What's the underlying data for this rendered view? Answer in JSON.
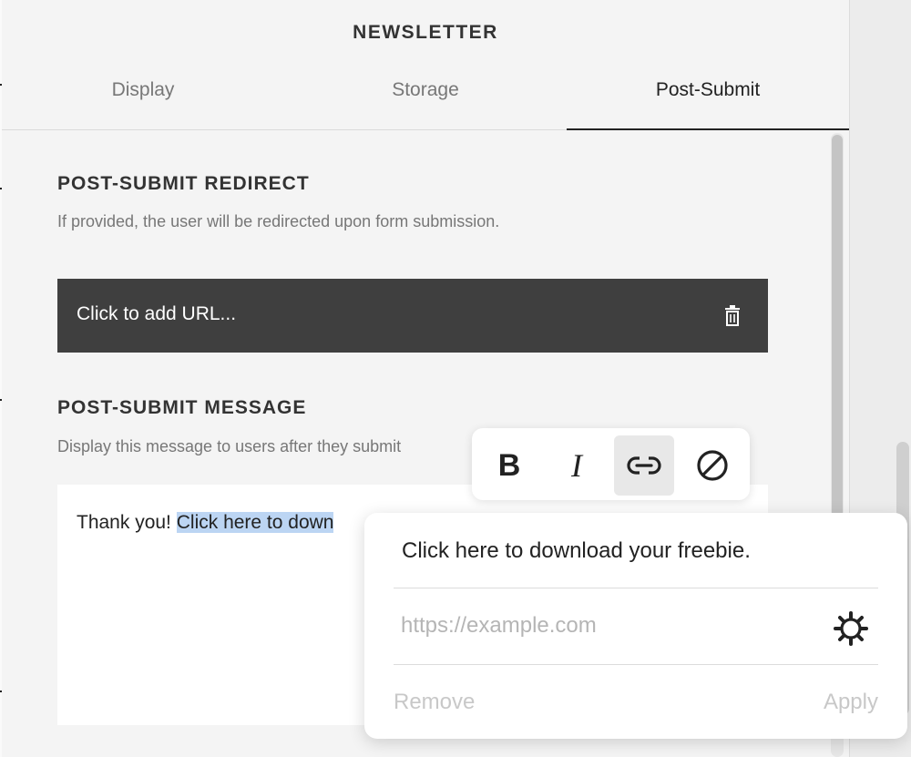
{
  "panel": {
    "title": "NEWSLETTER",
    "tabs": [
      {
        "label": "Display",
        "active": false
      },
      {
        "label": "Storage",
        "active": false
      },
      {
        "label": "Post-Submit",
        "active": true
      }
    ]
  },
  "redirect": {
    "heading": "POST-SUBMIT REDIRECT",
    "description": "If provided, the user will be redirected upon form submission.",
    "url_placeholder_text": "Click to add URL..."
  },
  "message": {
    "heading": "POST-SUBMIT MESSAGE",
    "description": "Display this message to users after they submit",
    "text_plain": "Thank you! ",
    "text_selected": "Click here to down"
  },
  "toolbar": {
    "icons": [
      "bold-icon",
      "italic-icon",
      "link-icon",
      "clear-format-icon"
    ],
    "bold_glyph": "B",
    "italic_glyph": "I",
    "active": "link"
  },
  "link_popup": {
    "link_text": "Click here to download your freebie.",
    "url_placeholder": "https://example.com",
    "remove_label": "Remove",
    "apply_label": "Apply"
  }
}
